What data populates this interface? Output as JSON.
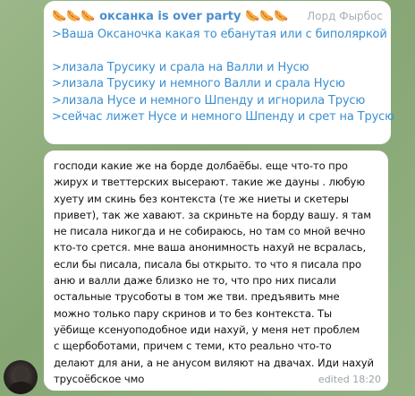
{
  "message1": {
    "title": "🌭🌭🌭 оксанка is over party 🌭🌭🌭",
    "author": "Лорд Фырбос",
    "lines": [
      ">Ваша Оксаночка какая то ебанутая или с биполяркой",
      ">лизала Трусику и срала на Валли и Нусю",
      ">лизала Трусику и немного Валли и срала Нусю",
      ">лизала Нусе и немного Шпенду и игнорила Трусю",
      ">сейчас лижет Нусе и немного Шпенду и срет на Трусю"
    ]
  },
  "message2": {
    "text": "господи какие же на борде долбаёбы. еще что-то про\nжирух и тветтерских высерают. такие же дауны . любую\nхуету им скинь без контекста (те же ниеты и скетеры\nпривет), так же хавают. за скриньте на борду вашу. я там\nне писала никогда и не  собираюсь, но там со мной вечно\nкто-то срется. мне ваша анонимность нахуй не всралась,\nесли бы писала, писала бы открыто.  то что я писала про\nаню и валли даже близко не то, что про них писали\nостальные трусоботы в том же тви. предъявить мне\nможно только пару скринов и то без контекста. Ты\nуёбище ксенуоподобное иди нахуй, у меня нет проблем\nс щербоботами, причем с теми, кто реально что-то\nделают для ани, а не анусом виляют на двачах. Иди нахуй\nтрусоёбское чмо",
    "time": "edited 18:20"
  }
}
